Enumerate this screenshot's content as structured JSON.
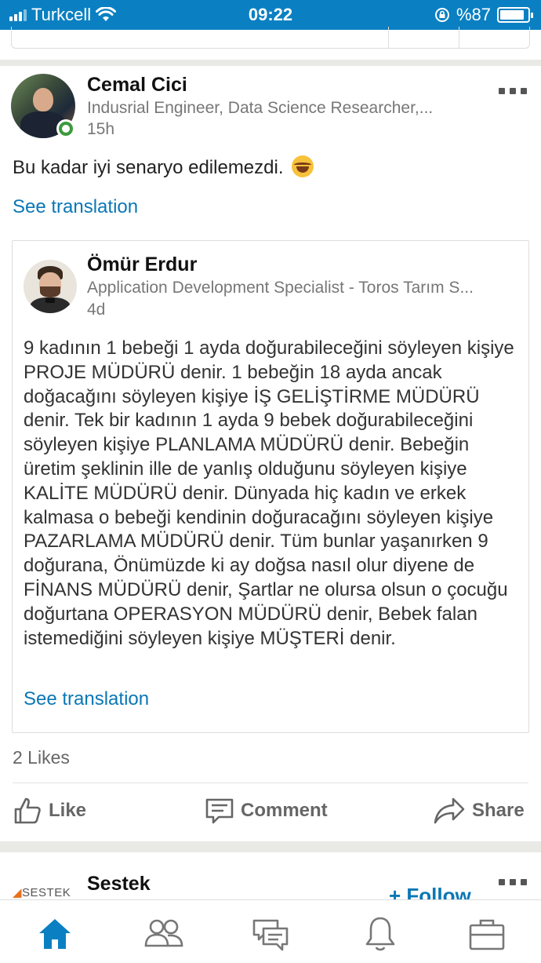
{
  "status_bar": {
    "carrier": "Turkcell",
    "time": "09:22",
    "battery": "%87"
  },
  "post": {
    "author_name": "Cemal Cici",
    "author_headline": "Indusrial Engineer, Data Science Researcher,...",
    "time_ago": "15h",
    "text": "Bu kadar iyi senaryo edilemezdi.",
    "see_translation": "See translation",
    "likes": "2 Likes",
    "actions": {
      "like": "Like",
      "comment": "Comment",
      "share": "Share"
    }
  },
  "shared_post": {
    "author_name": "Ömür Erdur",
    "author_headline": "Application Development Specialist - Toros Tarım S...",
    "time_ago": "4d",
    "text": "9 kadının 1 bebeği 1 ayda doğurabileceğini söyleyen kişiye PROJE MÜDÜRÜ denir. 1 bebeğin 18 ayda ancak doğacağını söyleyen kişiye İŞ GELİŞTİRME MÜDÜRÜ denir. Tek bir kadının 1 ayda 9 bebek doğurabileceğini söyleyen kişiye PLANLAMA MÜDÜRÜ denir. Bebeğin üretim şeklinin ille de yanlış olduğunu söyleyen kişiye KALİTE MÜDÜRÜ denir. Dünyada hiç kadın ve erkek kalmasa o bebeği kendinin doğuracağını söyleyen kişiye PAZARLAMA MÜDÜRÜ denir. Tüm bunlar yaşanırken 9 doğurana, Önümüzde ki ay doğsa nasıl olur diyene de FİNANS MÜDÜRÜ denir, Şartlar ne olursa olsun o çocuğu doğurtana OPERASYON MÜDÜRÜ denir, Bebek falan istemediğini söyleyen kişiye MÜŞTERİ denir.",
    "see_translation": "See translation"
  },
  "next_post": {
    "logo_text": "SESTEK",
    "author_name": "Sestek",
    "follow_label": "+ Follow"
  },
  "bottom_nav": [
    "home-icon",
    "network-icon",
    "messaging-icon",
    "notifications-icon",
    "jobs-icon"
  ],
  "colors": {
    "brand_blue": "#0a80c2",
    "link_blue": "#0a77b5",
    "online_green": "#3c9a3c"
  }
}
